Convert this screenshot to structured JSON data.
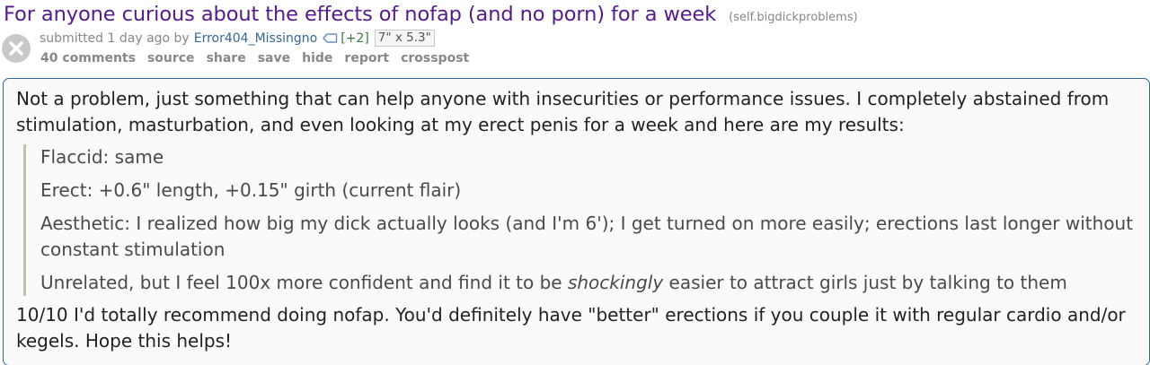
{
  "post": {
    "title": "For anyone curious about the effects of nofap (and no porn) for a week",
    "domain": "(self.bigdickproblems)",
    "tagline": {
      "submitted": "submitted 1 day ago by",
      "author": "Error404_Missingno",
      "karma": "[+2]",
      "flair": "7\" x 5.3\""
    },
    "buttons": [
      "40 comments",
      "source",
      "share",
      "save",
      "hide",
      "report",
      "crosspost"
    ],
    "selftext": {
      "intro": "Not a problem, just something that can help anyone with insecurities or performance issues. I completely abstained from stimulation, masturbation, and even looking at my erect penis for a week and here are my results:",
      "quote": [
        "Flaccid: same",
        "Erect: +0.6\" length, +0.15\" girth (current flair)",
        "Aesthetic: I realized how big my dick actually looks (and I'm 6'); I get turned on more easily; erections last longer without constant stimulation"
      ],
      "unrelated": {
        "before": "Unrelated, but I feel 100x more confident and find it to be ",
        "emphasis": "shockingly",
        "after": " easier to attract girls just by talking to them"
      },
      "conclusion": "10/10 I'd totally recommend doing nofap. You'd definitely have \"better\" erections if you couple it with regular cardio and/or kegels. Hope this helps!"
    }
  },
  "icons": {
    "thumbnail": "close-x-icon",
    "author_tag": "tag-icon"
  },
  "colors": {
    "title": "#551a8b",
    "author": "#336699",
    "karma": "#3b7b3b",
    "selftext_border": "#336699",
    "selftext_bg": "#fafafa"
  }
}
